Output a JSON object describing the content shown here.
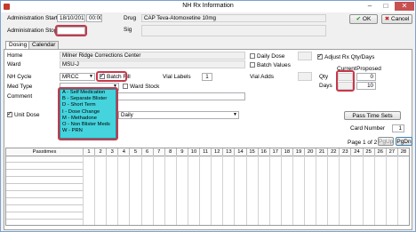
{
  "window": {
    "title": "NH Rx Information",
    "min": "–",
    "max": "□",
    "close": "✕"
  },
  "header": {
    "admin_start_label": "Administration Start",
    "admin_start_date": "18/10/2017",
    "admin_start_time": "00:00",
    "admin_stop_label": "Administration Stop",
    "admin_stop_value": "",
    "drug_label": "Drug",
    "drug_value": "CAP Teva-Atomoxetine 10mg",
    "sig_label": "Sig",
    "ok_label": "OK",
    "cancel_label": "Cancel"
  },
  "tabs": [
    "Dosing",
    "Calendar"
  ],
  "dosing": {
    "home_label": "Home",
    "home_value": "Milner Ridge Corrections Center",
    "ward_label": "Ward",
    "ward_value": "MSU-J",
    "nh_cycle_label": "NH Cycle",
    "nh_cycle_value": "MRCC",
    "batch_fill_label": "Batch Fill",
    "vial_labels_label": "Vial Labels",
    "vial_labels_value": "1",
    "med_type_label": "Med Type",
    "ward_stock_label": "Ward Stock",
    "comment_label": "Comment",
    "daily_dose_label": "Daily Dose",
    "batch_values_label": "Batch Values",
    "adjust_rx_label": "Adjust Rx Qty/Days",
    "vial_adds_label": "Vial Adds",
    "current_label": "Current",
    "proposed_label": "Proposed",
    "qty_label": "Qty",
    "qty_proposed": "0",
    "days_label": "Days",
    "days_proposed": "10",
    "unit_dose_label": "Unit Dose",
    "frequency_value": "Daily",
    "pass_time_sets_label": "Pass Time Sets",
    "card_number_label": "Card Number",
    "card_number_value": "1",
    "page_text": "Page 1 of 2",
    "pgup_label": "PgUp",
    "pgdn_label": "PgDn"
  },
  "med_type_options": [
    "A - Self Medication",
    "B - Separate Blister",
    "D - Short Term",
    "I - Dose Change",
    "M - Methadone",
    "O - Non Blister Meds",
    "W - PRN"
  ],
  "grid": {
    "passtimes_header": "Passtimes",
    "days": [
      "1",
      "2",
      "3",
      "4",
      "5",
      "6",
      "7",
      "8",
      "9",
      "10",
      "11",
      "12",
      "13",
      "14",
      "15",
      "16",
      "17",
      "18",
      "19",
      "20",
      "21",
      "22",
      "23",
      "24",
      "25",
      "26",
      "27",
      "28"
    ]
  },
  "colors": {
    "highlight": "#c8384a",
    "dropdown": "#45d3dd"
  }
}
